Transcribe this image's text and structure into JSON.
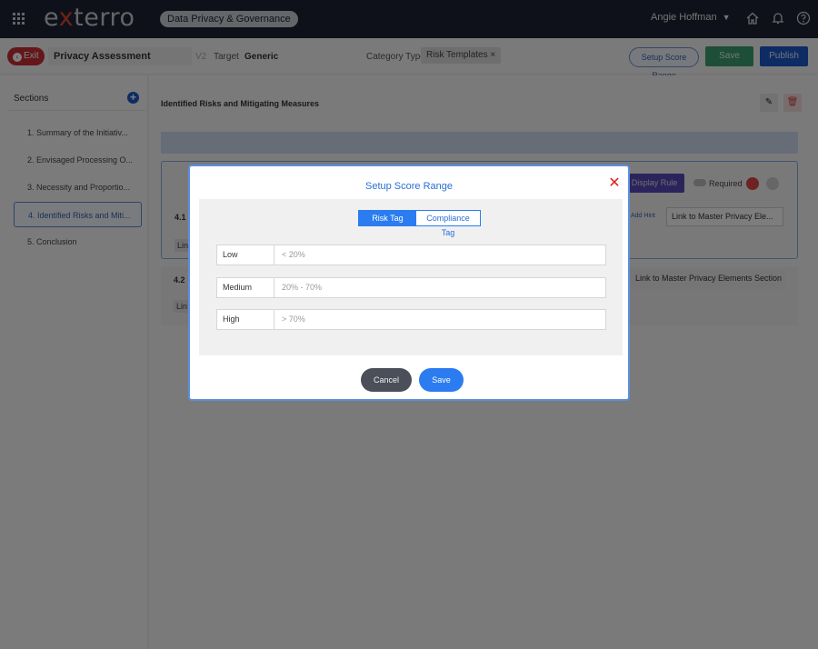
{
  "header": {
    "logo_prefix": "e",
    "logo_x": "x",
    "logo_suffix": "terro",
    "product": "Data Privacy & Governance",
    "user": "Angie Hoffman",
    "icons": [
      "apps-grid-icon",
      "home-icon",
      "bell-icon",
      "help-icon"
    ]
  },
  "toolbar": {
    "exit_label": "Exit",
    "assessment_title": "Privacy Assessment",
    "version": "V2",
    "target_label": "Target",
    "target_value": "Generic",
    "category_label": "Category Type:",
    "category_chip": "Risk Templates",
    "setup_range_label": "Setup Score Range",
    "save_label": "Save",
    "publish_label": "Publish"
  },
  "sidebar": {
    "title": "Sections",
    "items": [
      {
        "label": "1. Summary of the Initiativ..."
      },
      {
        "label": "2. Envisaged Processing O..."
      },
      {
        "label": "3. Necessity and Proportio..."
      },
      {
        "label": "4. Identified Risks and Miti..."
      },
      {
        "label": "5. Conclusion"
      }
    ],
    "active_index": 3
  },
  "main": {
    "section_title": "Identified Risks and Mitigating Measures",
    "q1_num": "4.1",
    "q2_num": "4.2",
    "display_rule": "Display Rule",
    "required_label": "Required",
    "add_hint": "Add Hint",
    "link_select_1": "Link to Master Privacy Ele...",
    "link_select_2": "Link to Master Privacy Elements Section",
    "chip_stub_1": "Lin",
    "chip_stub_2": "Lin"
  },
  "modal": {
    "title": "Setup Score Range",
    "tabs": [
      {
        "label": "Risk Tag",
        "active": true
      },
      {
        "label": "Compliance Tag",
        "active": false
      }
    ],
    "ranges": [
      {
        "label": "Low",
        "value": "< 20%"
      },
      {
        "label": "Medium",
        "value": "20% - 70%"
      },
      {
        "label": "High",
        "value": "> 70%"
      }
    ],
    "cancel_label": "Cancel",
    "save_label": "Save"
  },
  "colors": {
    "topbar": "#1d2232",
    "accent_blue": "#2a7cf0",
    "exit_red": "#c62f36",
    "save_green": "#3a9d6e",
    "publish_blue": "#1b58c9",
    "logo_x_red": "#e0452f"
  }
}
